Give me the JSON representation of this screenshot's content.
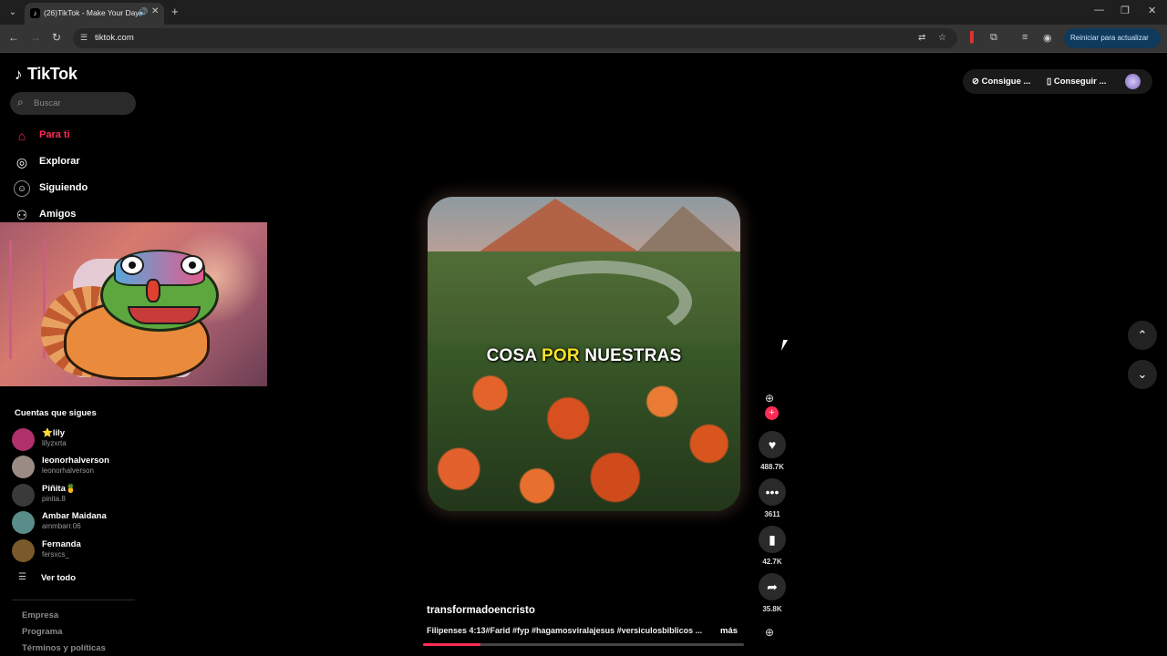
{
  "browser": {
    "tab_title": "(26)TikTok - Make Your Day",
    "url": "tiktok.com",
    "update_button": "Reiniciar para actualizar"
  },
  "tiktok": {
    "logo": "TikTok",
    "search_placeholder": "Buscar",
    "nav": [
      {
        "label": "Para ti",
        "icon": "home-icon",
        "active": true
      },
      {
        "label": "Explorar",
        "icon": "compass-icon"
      },
      {
        "label": "Siguiendo",
        "icon": "following-icon"
      },
      {
        "label": "Amigos",
        "icon": "friends-icon"
      }
    ],
    "following_title": "Cuentas que sigues",
    "accounts": [
      {
        "name": "⭐lily",
        "handle": "lilyzxrta",
        "color": "#b0306a"
      },
      {
        "name": "leonorhalverson",
        "handle": "leonorhalverson",
        "color": "#9a8c84"
      },
      {
        "name": "Piñita🍍",
        "handle": "pinita.8",
        "color": "#3a3a3a"
      },
      {
        "name": "Ambar Maidana",
        "handle": "ammbarr.06",
        "color": "#5a8d8a"
      },
      {
        "name": "Fernanda",
        "handle": "fersxcs_",
        "color": "#7a5a2a"
      }
    ],
    "see_all": "Ver todo",
    "footer": [
      "Empresa",
      "Programa",
      "Términos y políticas"
    ],
    "top_right": {
      "coins": "Consigue ...",
      "app": "Conseguir ..."
    },
    "video": {
      "caption_pre": "COSA ",
      "caption_hl": "POR",
      "caption_post": " NUESTRAS",
      "author": "transformadoencristo",
      "description": "Filipenses 4:13#Farid #fyp #hagamosviralajesus #versiculosbiblicos ...",
      "more": "más",
      "progress": 0.18
    },
    "actions": {
      "likes": "488.7K",
      "comments": "3611",
      "saves": "42.7K",
      "shares": "35.8K"
    }
  },
  "colors": {
    "accent": "#fe2c55",
    "background": "#000000"
  }
}
